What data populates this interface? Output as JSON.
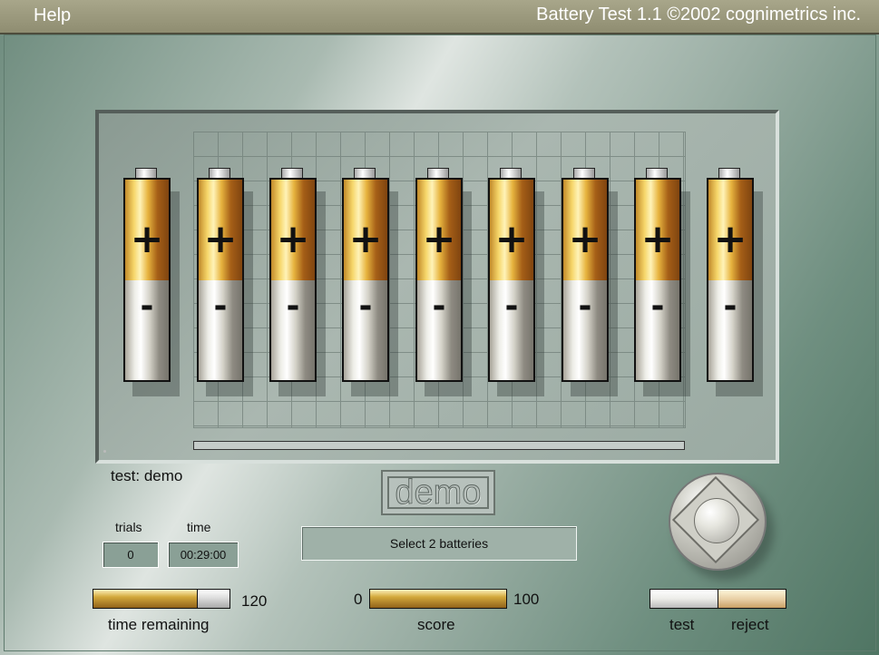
{
  "topbar": {
    "help_label": "Help",
    "title": "Battery  Test 1.1 ©2002  cognimetrics inc."
  },
  "test_info": {
    "label": "test: demo"
  },
  "demo_logo": "demo",
  "counters": {
    "trials_label": "trials",
    "trials_value": "0",
    "time_label": "time",
    "time_value": "00:29:00"
  },
  "status_message": "Select 2 batteries",
  "time_bar": {
    "label": "time remaining",
    "max_text": "120",
    "fill_percent": 0.73
  },
  "score_bar": {
    "label": "score",
    "min_text": "0",
    "max_text": "100",
    "fill_percent": 1.0
  },
  "actions": {
    "test_label": "test",
    "reject_label": "reject"
  },
  "batteries": [
    {
      "plus": "+",
      "minus": "-"
    },
    {
      "plus": "+",
      "minus": "-"
    },
    {
      "plus": "+",
      "minus": "-"
    },
    {
      "plus": "+",
      "minus": "-"
    },
    {
      "plus": "+",
      "minus": "-"
    },
    {
      "plus": "+",
      "minus": "-"
    },
    {
      "plus": "+",
      "minus": "-"
    },
    {
      "plus": "+",
      "minus": "-"
    },
    {
      "plus": "+",
      "minus": "-"
    }
  ],
  "icons": {
    "joystick": "joystick-icon"
  }
}
